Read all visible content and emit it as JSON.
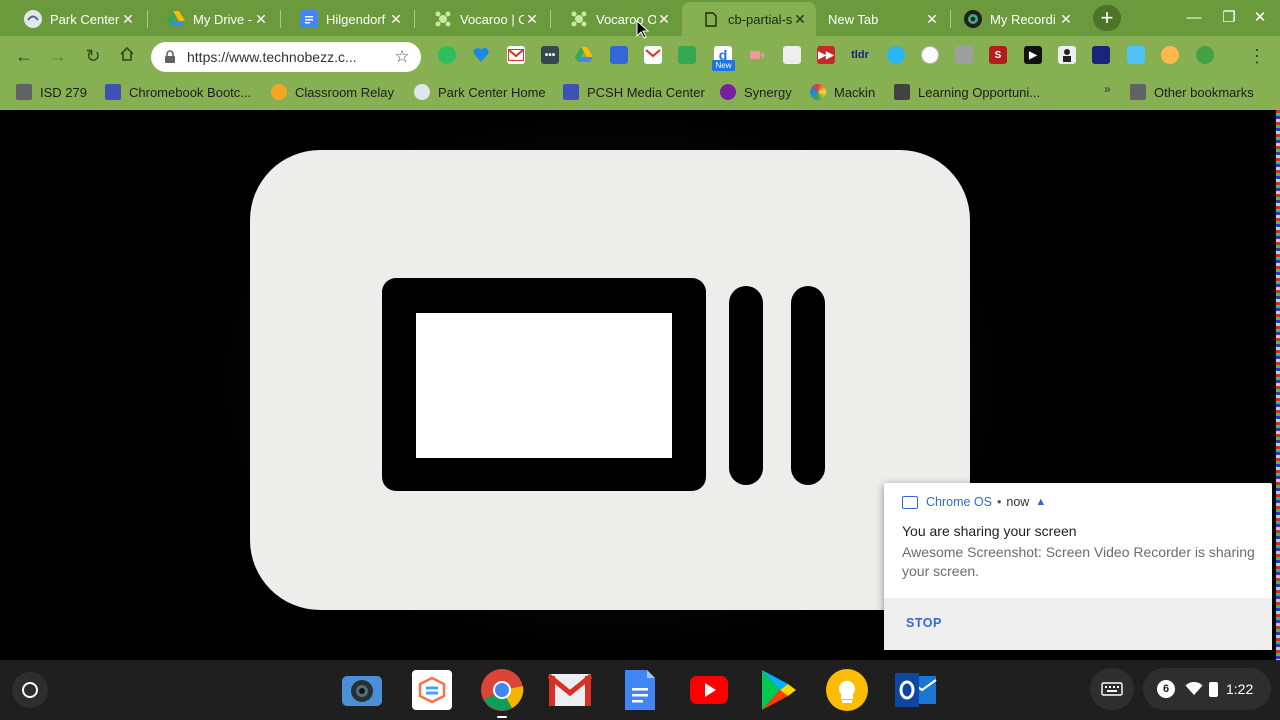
{
  "tabs": [
    {
      "title": "Park Center",
      "icon": "park-center-favicon"
    },
    {
      "title": "My Drive - G",
      "icon": "google-drive-icon"
    },
    {
      "title": "Hilgendorf",
      "icon": "google-docs-icon"
    },
    {
      "title": "Vocaroo | O",
      "icon": "vocaroo-icon"
    },
    {
      "title": "Vocaroo O",
      "icon": "vocaroo-icon"
    },
    {
      "title": "cb-partial-s",
      "icon": "file-icon"
    },
    {
      "title": "New Tab",
      "icon": ""
    },
    {
      "title": "My Recordi",
      "icon": "awesome-screenshot-icon"
    }
  ],
  "active_tab": "cb-partial-s",
  "omnibox": {
    "url": "https://www.technobezz.c..."
  },
  "bookmarks": [
    {
      "label": "ISD 279",
      "icon": "folder-icon"
    },
    {
      "label": "Chromebook Bootc...",
      "icon": "site-icon"
    },
    {
      "label": "Classroom Relay",
      "icon": "relay-icon"
    },
    {
      "label": "Park Center Home",
      "icon": "park-center-favicon"
    },
    {
      "label": "PCSH Media Center",
      "icon": "site-icon"
    },
    {
      "label": "Synergy",
      "icon": "synergy-icon"
    },
    {
      "label": "Mackin",
      "icon": "mackin-icon"
    },
    {
      "label": "Learning Opportuni...",
      "icon": "cube-icon"
    }
  ],
  "bookmarks_overflow": "»",
  "other_bookmarks": "Other bookmarks",
  "extension_badge": "New",
  "notification": {
    "source": "Chrome OS",
    "separator": "•",
    "time": "now",
    "title": "You are sharing your screen",
    "body": "Awesome Screenshot: Screen Video Recorder is sharing your screen.",
    "action": "STOP"
  },
  "shelf_apps": [
    "camera",
    "screencastify",
    "chrome",
    "gmail",
    "google-docs",
    "youtube",
    "play-store",
    "keep",
    "outlook"
  ],
  "tray": {
    "notification_count": "6",
    "time": "1:22"
  },
  "colors": {
    "frame": "#6b9a3c",
    "toolbar": "#86b052",
    "accent": "#3367d6"
  }
}
